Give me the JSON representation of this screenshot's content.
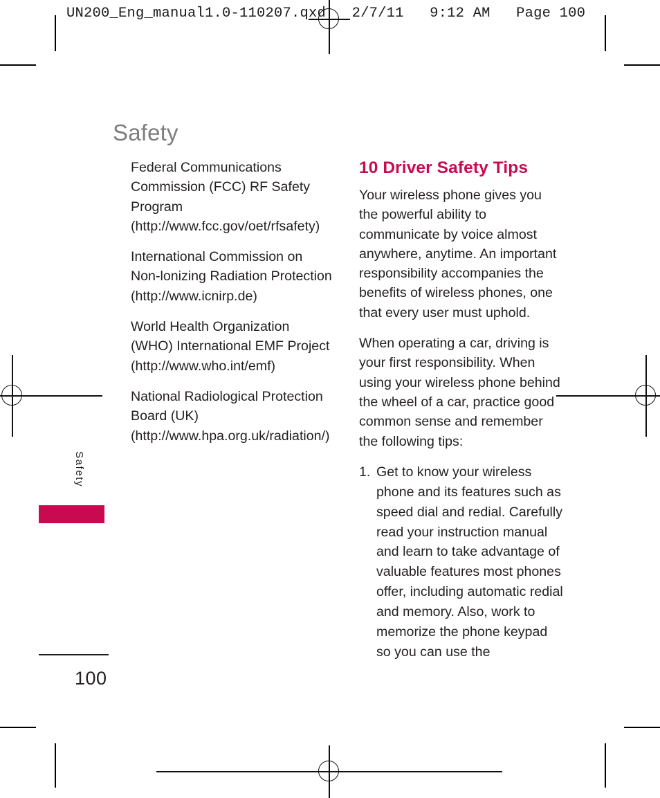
{
  "print_slug": {
    "text": "UN200_Eng_manual1.0-110207.qxd   2/7/11   9:12 AM   Page 100"
  },
  "page": {
    "title": "Safety",
    "folio": "100",
    "thumb_tab_label": "Safety"
  },
  "colors": {
    "accent": "#C80A50",
    "title_gray": "#7D7D7D",
    "body_text": "#231F20"
  },
  "left_column": {
    "paragraphs": [
      "Federal Communications Commission (FCC) RF Safety Program (http://www.fcc.gov/oet/rfsafety)",
      "International Commission on Non-lonizing Radiation Protection (http://www.icnirp.de)",
      "World Health Organization (WHO) International EMF Project (http://www.who.int/emf)",
      "National Radiological Protection Board (UK) (http://www.hpa.org.uk/radiation/)"
    ]
  },
  "right_column": {
    "heading": "10 Driver Safety Tips",
    "paragraphs": [
      "Your wireless phone gives you the powerful ability to communicate by voice almost anywhere, anytime. An important responsibility accompanies the benefits of wireless phones, one that every user must uphold.",
      "When operating a car, driving is your first responsibility. When using your wireless phone behind the wheel of a car, practice good common sense and remember the following tips:"
    ],
    "tips": [
      {
        "number": "1.",
        "text": "Get to know your wireless phone and its features such as speed dial and redial. Carefully read your instruction manual and learn to take advantage of valuable features most phones offer, including automatic redial and memory. Also, work to memorize the phone keypad so you can use the"
      }
    ]
  }
}
